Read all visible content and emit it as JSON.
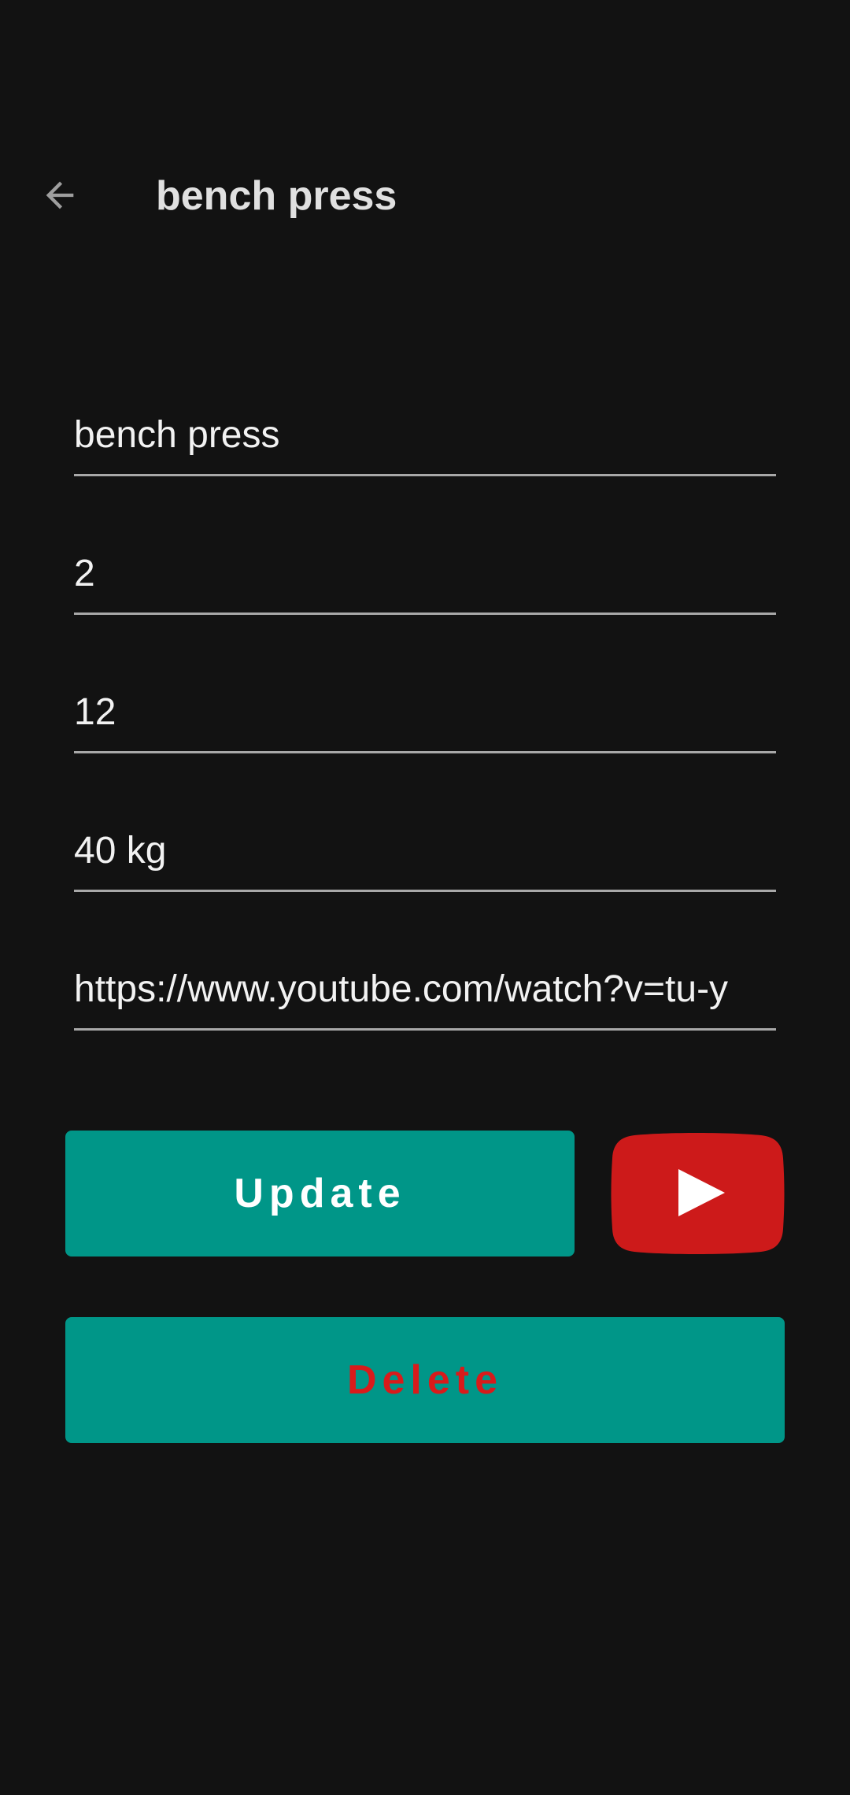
{
  "app_bar": {
    "title": "bench press",
    "back_icon": "arrow-left-icon"
  },
  "form": {
    "name": "bench press",
    "sets": "2",
    "reps": "12",
    "weight": "40 kg",
    "video_url": "https://www.youtube.com/watch?v=tu-y"
  },
  "buttons": {
    "update_label": "Update",
    "delete_label": "Delete",
    "youtube_icon": "youtube-play-icon"
  },
  "colors": {
    "background": "#121212",
    "accent": "#009688",
    "delete_text": "#d81b1b",
    "youtube_red": "#cd1a1a"
  }
}
